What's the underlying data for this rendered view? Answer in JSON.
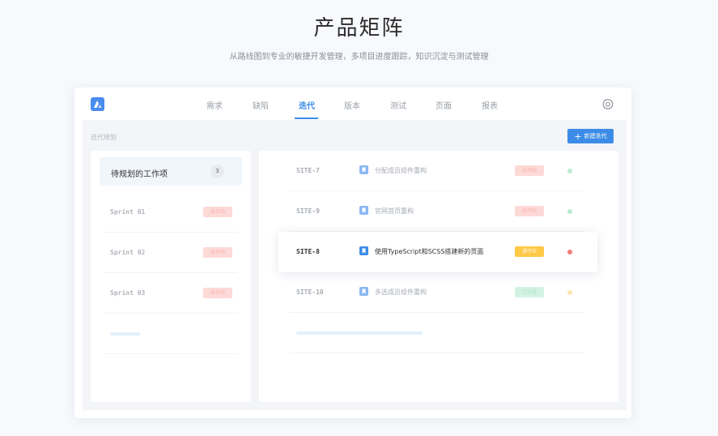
{
  "page": {
    "title": "产品矩阵",
    "subtitle": "从路线图到专业的敏捷开发管理，多项目进度跟踪，知识沉淀与测试管理"
  },
  "colors": {
    "accent": "#3c8ce7",
    "pending": "#fdd9d7",
    "in_progress": "#ffc845",
    "done": "#d4f2e3",
    "dot_green": "#b8ead0",
    "dot_red": "#f27f77",
    "dot_yellow": "#fde7b0"
  },
  "nav": {
    "logo_icon": "product-logo-icon",
    "items": [
      {
        "label": "需求",
        "active": false
      },
      {
        "label": "缺陷",
        "active": false
      },
      {
        "label": "迭代",
        "active": true
      },
      {
        "label": "版本",
        "active": false
      },
      {
        "label": "测试",
        "active": false
      },
      {
        "label": "页面",
        "active": false
      },
      {
        "label": "报表",
        "active": false
      }
    ],
    "settings_icon": "gear-icon"
  },
  "toolbar": {
    "section_label": "迭代规划",
    "new_button_label": "新建迭代",
    "new_button_icon": "plus-icon"
  },
  "left_panel": {
    "backlog": {
      "label": "待规划的工作项",
      "count": "3"
    },
    "sprints": [
      {
        "name": "Sprint 01",
        "status": "未开始"
      },
      {
        "name": "Sprint 02",
        "status": "未开始"
      },
      {
        "name": "Sprint 03",
        "status": "未开始"
      }
    ]
  },
  "right_panel": {
    "tasks": [
      {
        "id": "SITE-7",
        "icon": "bookmark-icon",
        "title": "分配成员组件重构",
        "status": "未开始",
        "status_type": "pending",
        "dot": "green"
      },
      {
        "id": "SITE-9",
        "icon": "bookmark-icon",
        "title": "官网首页重构",
        "status": "未开始",
        "status_type": "pending",
        "dot": "green"
      },
      {
        "id": "SITE-8",
        "icon": "bookmark-icon",
        "title": "使用TypeScript和SCSS搭建新的页面",
        "status": "进行中",
        "status_type": "progress",
        "dot": "red"
      },
      {
        "id": "SITE-10",
        "icon": "bookmark-icon",
        "title": "多选成员组件重构",
        "status": "已完成",
        "status_type": "done",
        "dot": "yellow"
      }
    ]
  }
}
